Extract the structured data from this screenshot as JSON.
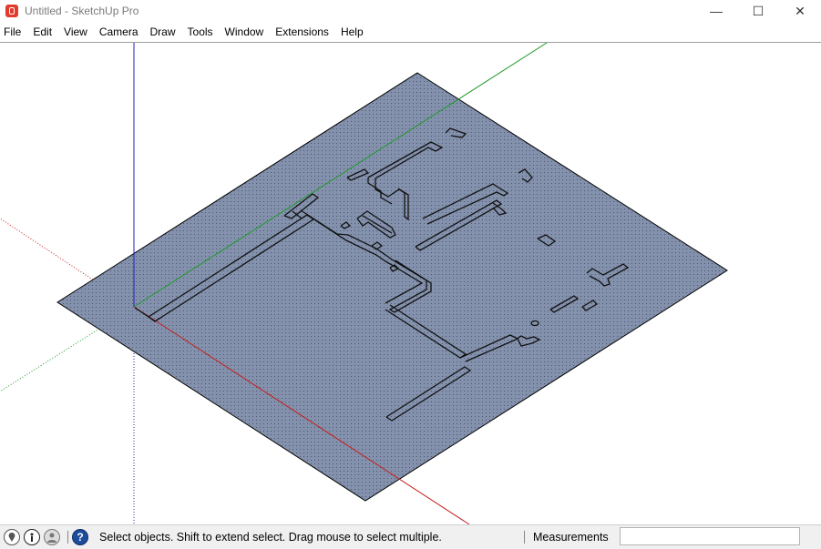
{
  "window": {
    "title": "Untitled - SketchUp Pro",
    "minimize_glyph": "—",
    "maximize_glyph": "☐",
    "close_glyph": "✕"
  },
  "menu": {
    "items": [
      "File",
      "Edit",
      "View",
      "Camera",
      "Draw",
      "Tools",
      "Window",
      "Extensions",
      "Help"
    ]
  },
  "viewport": {
    "model": "floor plan face with wall outlines",
    "axes_colors": {
      "red": "#c42020",
      "green": "#1f9a2a",
      "blue": "#2020c0"
    },
    "face_color": "#8391ac"
  },
  "statusbar": {
    "icons": [
      "geo-location-icon",
      "credits-icon",
      "user-icon",
      "help-icon"
    ],
    "help_glyph": "?",
    "status_text": "Select objects. Shift to extend select. Drag mouse to select multiple.",
    "measurements_label": "Measurements",
    "measurements_value": ""
  }
}
